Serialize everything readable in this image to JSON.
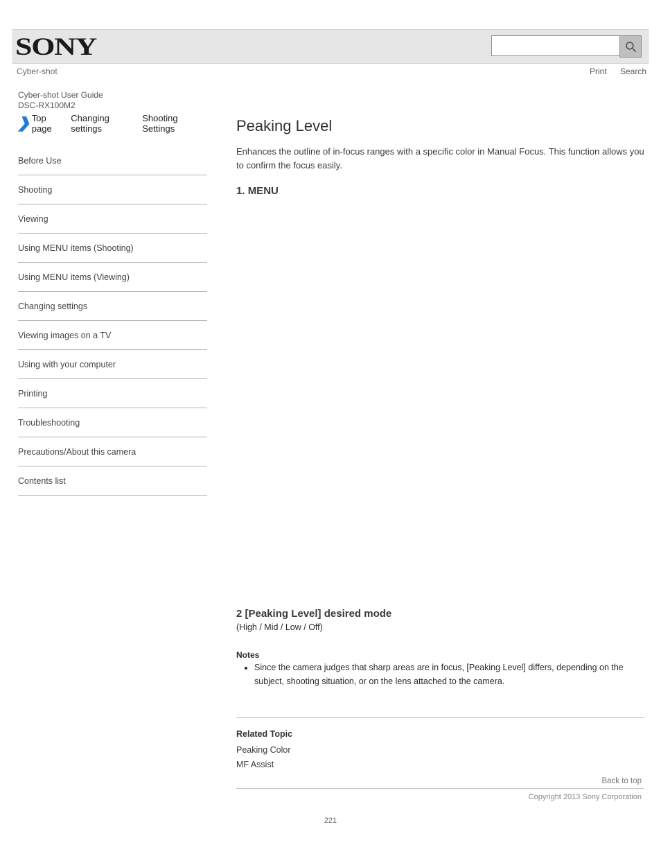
{
  "header": {
    "logo": "SONY",
    "model": "Cyber-shot",
    "links": {
      "print": "Print",
      "search": "Search"
    },
    "search_placeholder": ""
  },
  "doc": {
    "line1": "Cyber-shot User Guide",
    "line2": "DSC-RX100M2"
  },
  "sidebar": {
    "heading": "Top page",
    "crumb": "Changing settings",
    "crumb2": "Shooting Settings",
    "items": [
      "Before Use",
      "Shooting",
      "Viewing",
      "Using MENU items (Shooting)",
      "Using MENU items (Viewing)",
      "Changing settings",
      "Viewing images on a TV",
      "Using with your computer",
      "Printing",
      "Troubleshooting",
      "Precautions/About this camera",
      "Contents list"
    ]
  },
  "article": {
    "title": "Peaking Level",
    "intro_before": "Enhances the outline of in-focus ranges with a specific color in Manual Focus.",
    "intro_after": "This function allows you to confirm the focus easily.",
    "menu_prefix": "MENU ",
    "menu_gear_num": " 2",
    "menu_path": " [Peaking Level]  desired mode",
    "step1": "1.",
    "options_label": "(High / Mid / Low / Off)",
    "note_heading": "Notes",
    "notes": [
      "Since the camera judges that sharp areas are in focus, [Peaking Level] differs, depending on the subject, shooting situation, or on the lens attached to the camera."
    ],
    "related_heading": "Related Topic",
    "related": [
      "Peaking Color",
      "MF Assist"
    ]
  },
  "footer": {
    "backtop": "Back to top",
    "copyright": "Copyright 2013 Sony Corporation"
  },
  "page_number": "221"
}
